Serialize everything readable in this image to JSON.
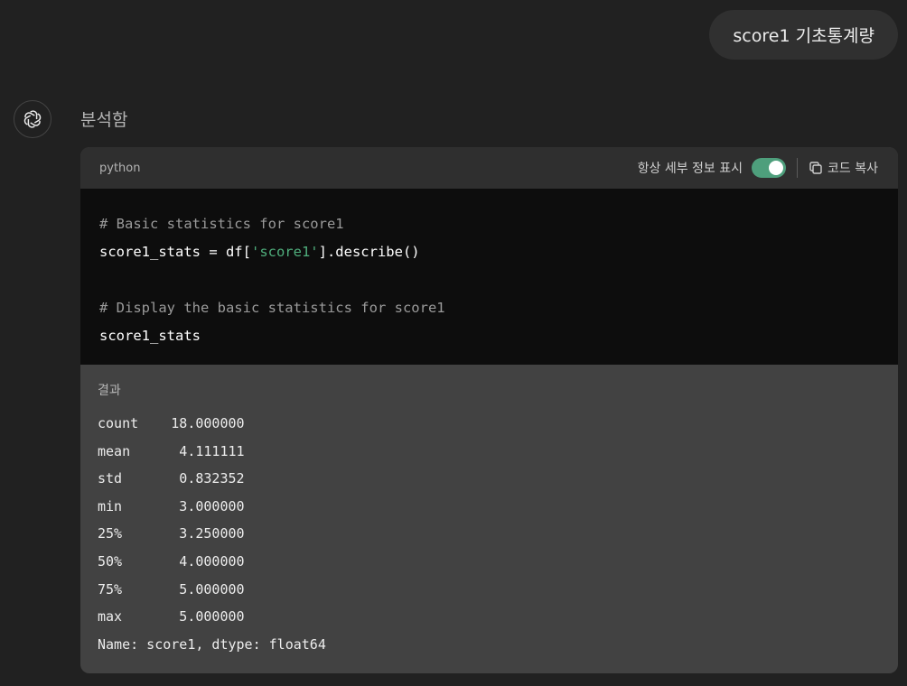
{
  "user_message": "score1 기초통계량",
  "assistant": {
    "status": "분석함"
  },
  "code_block": {
    "language": "python",
    "toggle_label": "항상 세부 정보 표시",
    "toggle_on": true,
    "copy_label": "코드 복사",
    "lines": {
      "l1": "# Basic statistics for score1",
      "l2_a": "score1_stats = df[",
      "l2_b": "'score1'",
      "l2_c": "].describe()",
      "l4": "# Display the basic statistics for score1",
      "l5": "score1_stats"
    }
  },
  "result": {
    "label": "결과",
    "lines": [
      "count    18.000000",
      "mean      4.111111",
      "std       0.832352",
      "min       3.000000",
      "25%       3.250000",
      "50%       4.000000",
      "75%       5.000000",
      "max       5.000000",
      "Name: score1, dtype: float64"
    ]
  },
  "colors": {
    "background": "#212121",
    "code_background": "#0d0d0d",
    "result_background": "#424242",
    "toggle_on": "#4e9f7c",
    "string": "#4fae7c"
  }
}
